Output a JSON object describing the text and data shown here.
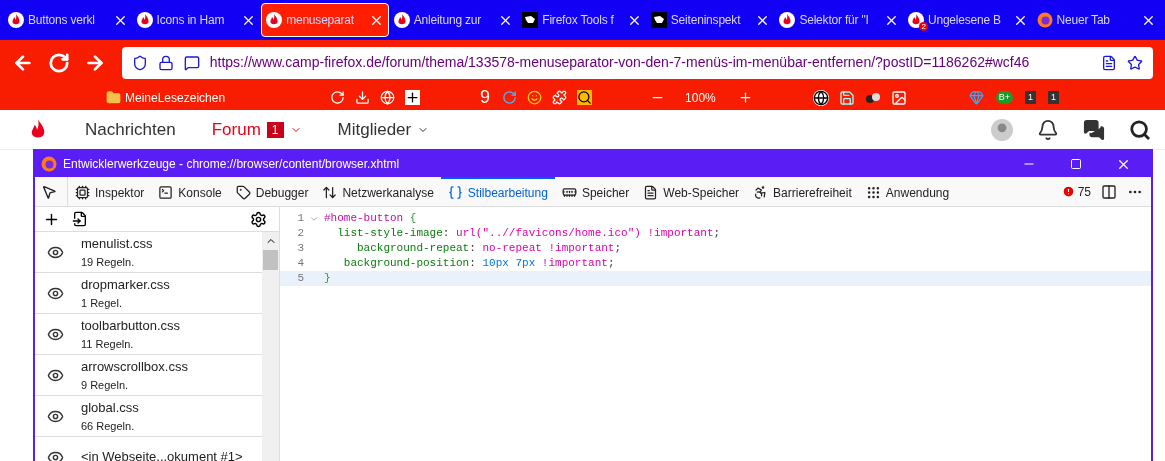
{
  "browser_tabs": [
    {
      "title": "Buttons verkl",
      "kind": "forum",
      "selected": false
    },
    {
      "title": "Icons in Ham",
      "kind": "forum",
      "selected": false
    },
    {
      "title": "menuseparat",
      "kind": "forum",
      "selected": true
    },
    {
      "title": "Anleitung zur",
      "kind": "forum",
      "selected": false
    },
    {
      "title": "Firefox Tools f",
      "kind": "tools",
      "selected": false
    },
    {
      "title": "Seiteninspekt",
      "kind": "tools",
      "selected": false
    },
    {
      "title": "Selektor für \"I",
      "kind": "forum",
      "selected": false
    },
    {
      "title": "Ungelesene B",
      "kind": "forum",
      "badge": "2",
      "selected": false
    },
    {
      "title": "Neuer Tab",
      "kind": "newtab",
      "selected": false
    }
  ],
  "url": {
    "host": "https://www.camp-firefox.de",
    "path": "/forum/thema/133578-menuseparator-von-den-7-menüs-im-menübar-entfernen/?postID=1186262#wcf46"
  },
  "bookmarks_bar": {
    "folder": "MeineLesezeichen",
    "counter": "9",
    "zoom": "100%",
    "badges": [
      "B+",
      "1",
      "1"
    ]
  },
  "site_nav": [
    {
      "label": "Nachrichten",
      "selected": false
    },
    {
      "label": "Forum",
      "badge": "1",
      "selected": true
    },
    {
      "label": "Mitglieder",
      "selected": false
    }
  ],
  "devtools": {
    "title": "Entwicklerwerkzeuge - chrome://browser/content/browser.xhtml",
    "tools": [
      {
        "label": "Inspektor",
        "selected": false
      },
      {
        "label": "Konsole",
        "selected": false
      },
      {
        "label": "Debugger",
        "selected": false
      },
      {
        "label": "Netzwerkanalyse",
        "selected": false
      },
      {
        "label": "Stilbearbeitung",
        "selected": true
      },
      {
        "label": "Speicher",
        "selected": false
      },
      {
        "label": "Web-Speicher",
        "selected": false
      },
      {
        "label": "Barrierefreiheit",
        "selected": false
      },
      {
        "label": "Anwendung",
        "selected": false
      }
    ],
    "error_count": "75",
    "stylesheets": [
      {
        "name": "menulist.css",
        "rules": "19 Regeln."
      },
      {
        "name": "dropmarker.css",
        "rules": "1 Regel."
      },
      {
        "name": "toolbarbutton.css",
        "rules": "11 Regeln."
      },
      {
        "name": "arrowscrollbox.css",
        "rules": "9 Regeln."
      },
      {
        "name": "global.css",
        "rules": "66 Regeln."
      },
      {
        "name": "<in Webseite...okument #1>"
      }
    ],
    "code_lines": [
      {
        "number": "1",
        "selected": false,
        "tokens": [
          {
            "text": "#home-button",
            "kind": "selector"
          },
          {
            "text": " {",
            "kind": "brace"
          }
        ]
      },
      {
        "number": "2",
        "selected": false,
        "tokens": [
          {
            "text": "  list-style-image",
            "kind": "property"
          },
          {
            "text": ": ",
            "kind": "plain"
          },
          {
            "text": "url(\"..//favicons/home.ico\")",
            "kind": "value"
          },
          {
            "text": " !important",
            "kind": "value"
          },
          {
            "text": ";",
            "kind": "plain"
          }
        ]
      },
      {
        "number": "3",
        "selected": false,
        "tokens": [
          {
            "text": "     background-repeat",
            "kind": "property"
          },
          {
            "text": ": ",
            "kind": "plain"
          },
          {
            "text": "no-repeat",
            "kind": "value"
          },
          {
            "text": " !important",
            "kind": "value"
          },
          {
            "text": ";",
            "kind": "plain"
          }
        ]
      },
      {
        "number": "4",
        "selected": false,
        "tokens": [
          {
            "text": "   background-position",
            "kind": "property"
          },
          {
            "text": ": ",
            "kind": "plain"
          },
          {
            "text": "10px 7px",
            "kind": "number"
          },
          {
            "text": " !important",
            "kind": "value"
          },
          {
            "text": ";",
            "kind": "plain"
          }
        ]
      },
      {
        "number": "5",
        "selected": true,
        "tokens": [
          {
            "text": "}",
            "kind": "brace"
          }
        ]
      }
    ]
  }
}
